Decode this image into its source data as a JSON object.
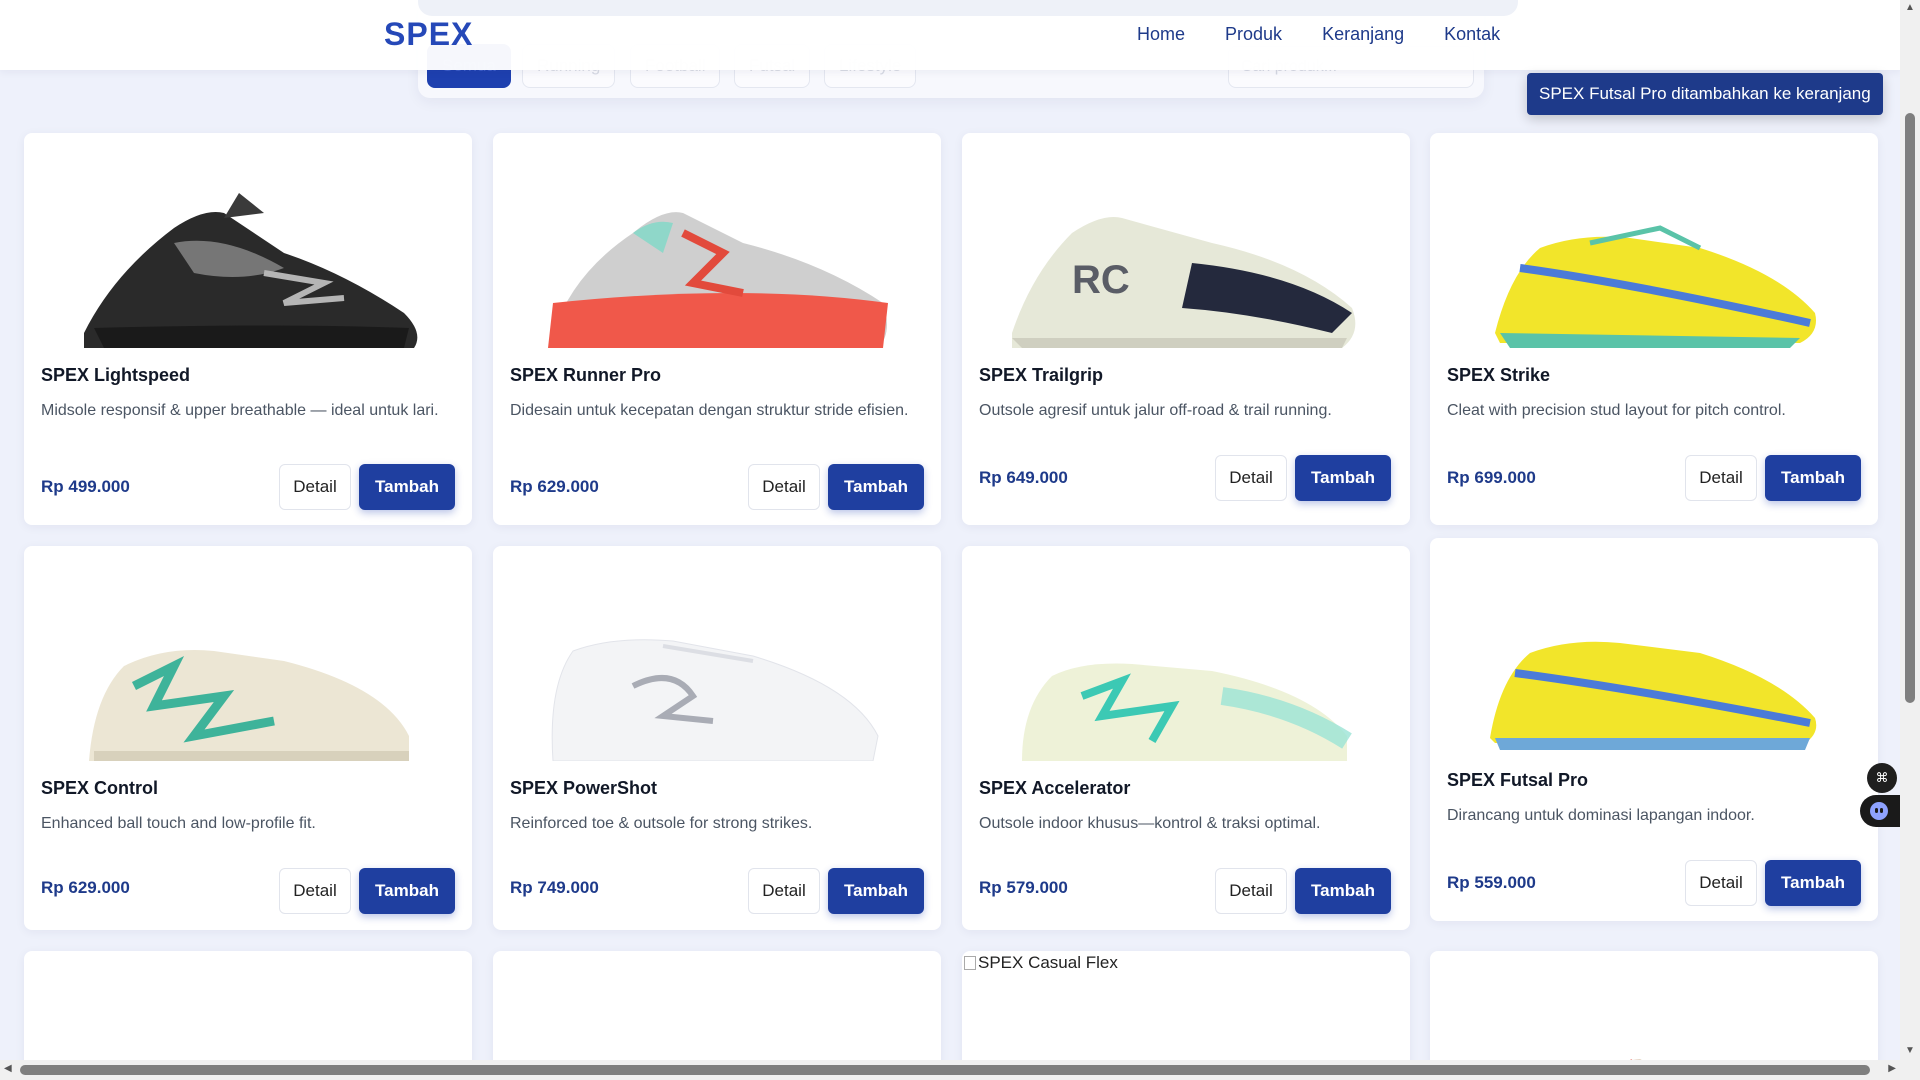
{
  "header": {
    "logo": "SPEX",
    "nav": [
      "Home",
      "Produk",
      "Keranjang",
      "Kontak"
    ]
  },
  "filters": {
    "tabs": [
      "Semua",
      "Running",
      "Football",
      "Futsal",
      "Lifestyle"
    ],
    "active": "Semua",
    "search_placeholder": "Cari produk..."
  },
  "toast": "SPEX Futsal Pro ditambahkan ke keranjang",
  "buttons": {
    "detail": "Detail",
    "add": "Tambah"
  },
  "products": [
    {
      "name": "SPEX Lightspeed",
      "desc": "Midsole responsif & upper breathable — ideal untuk lari.",
      "price": "Rp 499.000",
      "image": "black-running-shoe"
    },
    {
      "name": "SPEX Runner Pro",
      "desc": "Didesain untuk kecepatan dengan struktur stride efisien.",
      "price": "Rp 629.000",
      "image": "coral-running-shoe"
    },
    {
      "name": "SPEX Trailgrip",
      "desc": "Outsole agresif untuk jalur off-road & trail running.",
      "price": "Rp 649.000",
      "image": "cream-navy-running-shoe"
    },
    {
      "name": "SPEX Strike",
      "desc": "Cleat with precision stud layout for pitch control.",
      "price": "Rp 699.000",
      "image": "yellow-football-boot"
    },
    {
      "name": "SPEX Control",
      "desc": "Enhanced ball touch and low-profile fit.",
      "price": "Rp 629.000",
      "image": "cream-green-football-boot"
    },
    {
      "name": "SPEX PowerShot",
      "desc": "Reinforced toe & outsole for strong strikes.",
      "price": "Rp 749.000",
      "image": "white-football-boot"
    },
    {
      "name": "SPEX Accelerator",
      "desc": "Outsole indoor khusus—kontrol & traksi optimal.",
      "price": "Rp 579.000",
      "image": "mint-futsal-shoe"
    },
    {
      "name": "SPEX Futsal Pro",
      "desc": "Dirancang untuk dominasi lapangan indoor.",
      "price": "Rp 559.000",
      "image": "yellow-futsal-shoe"
    }
  ],
  "broken_image_alt": "SPEX Casual Flex",
  "colors": {
    "primary": "#1f3fa0",
    "price": "#1e3a8a",
    "background": "#eef1fb"
  }
}
